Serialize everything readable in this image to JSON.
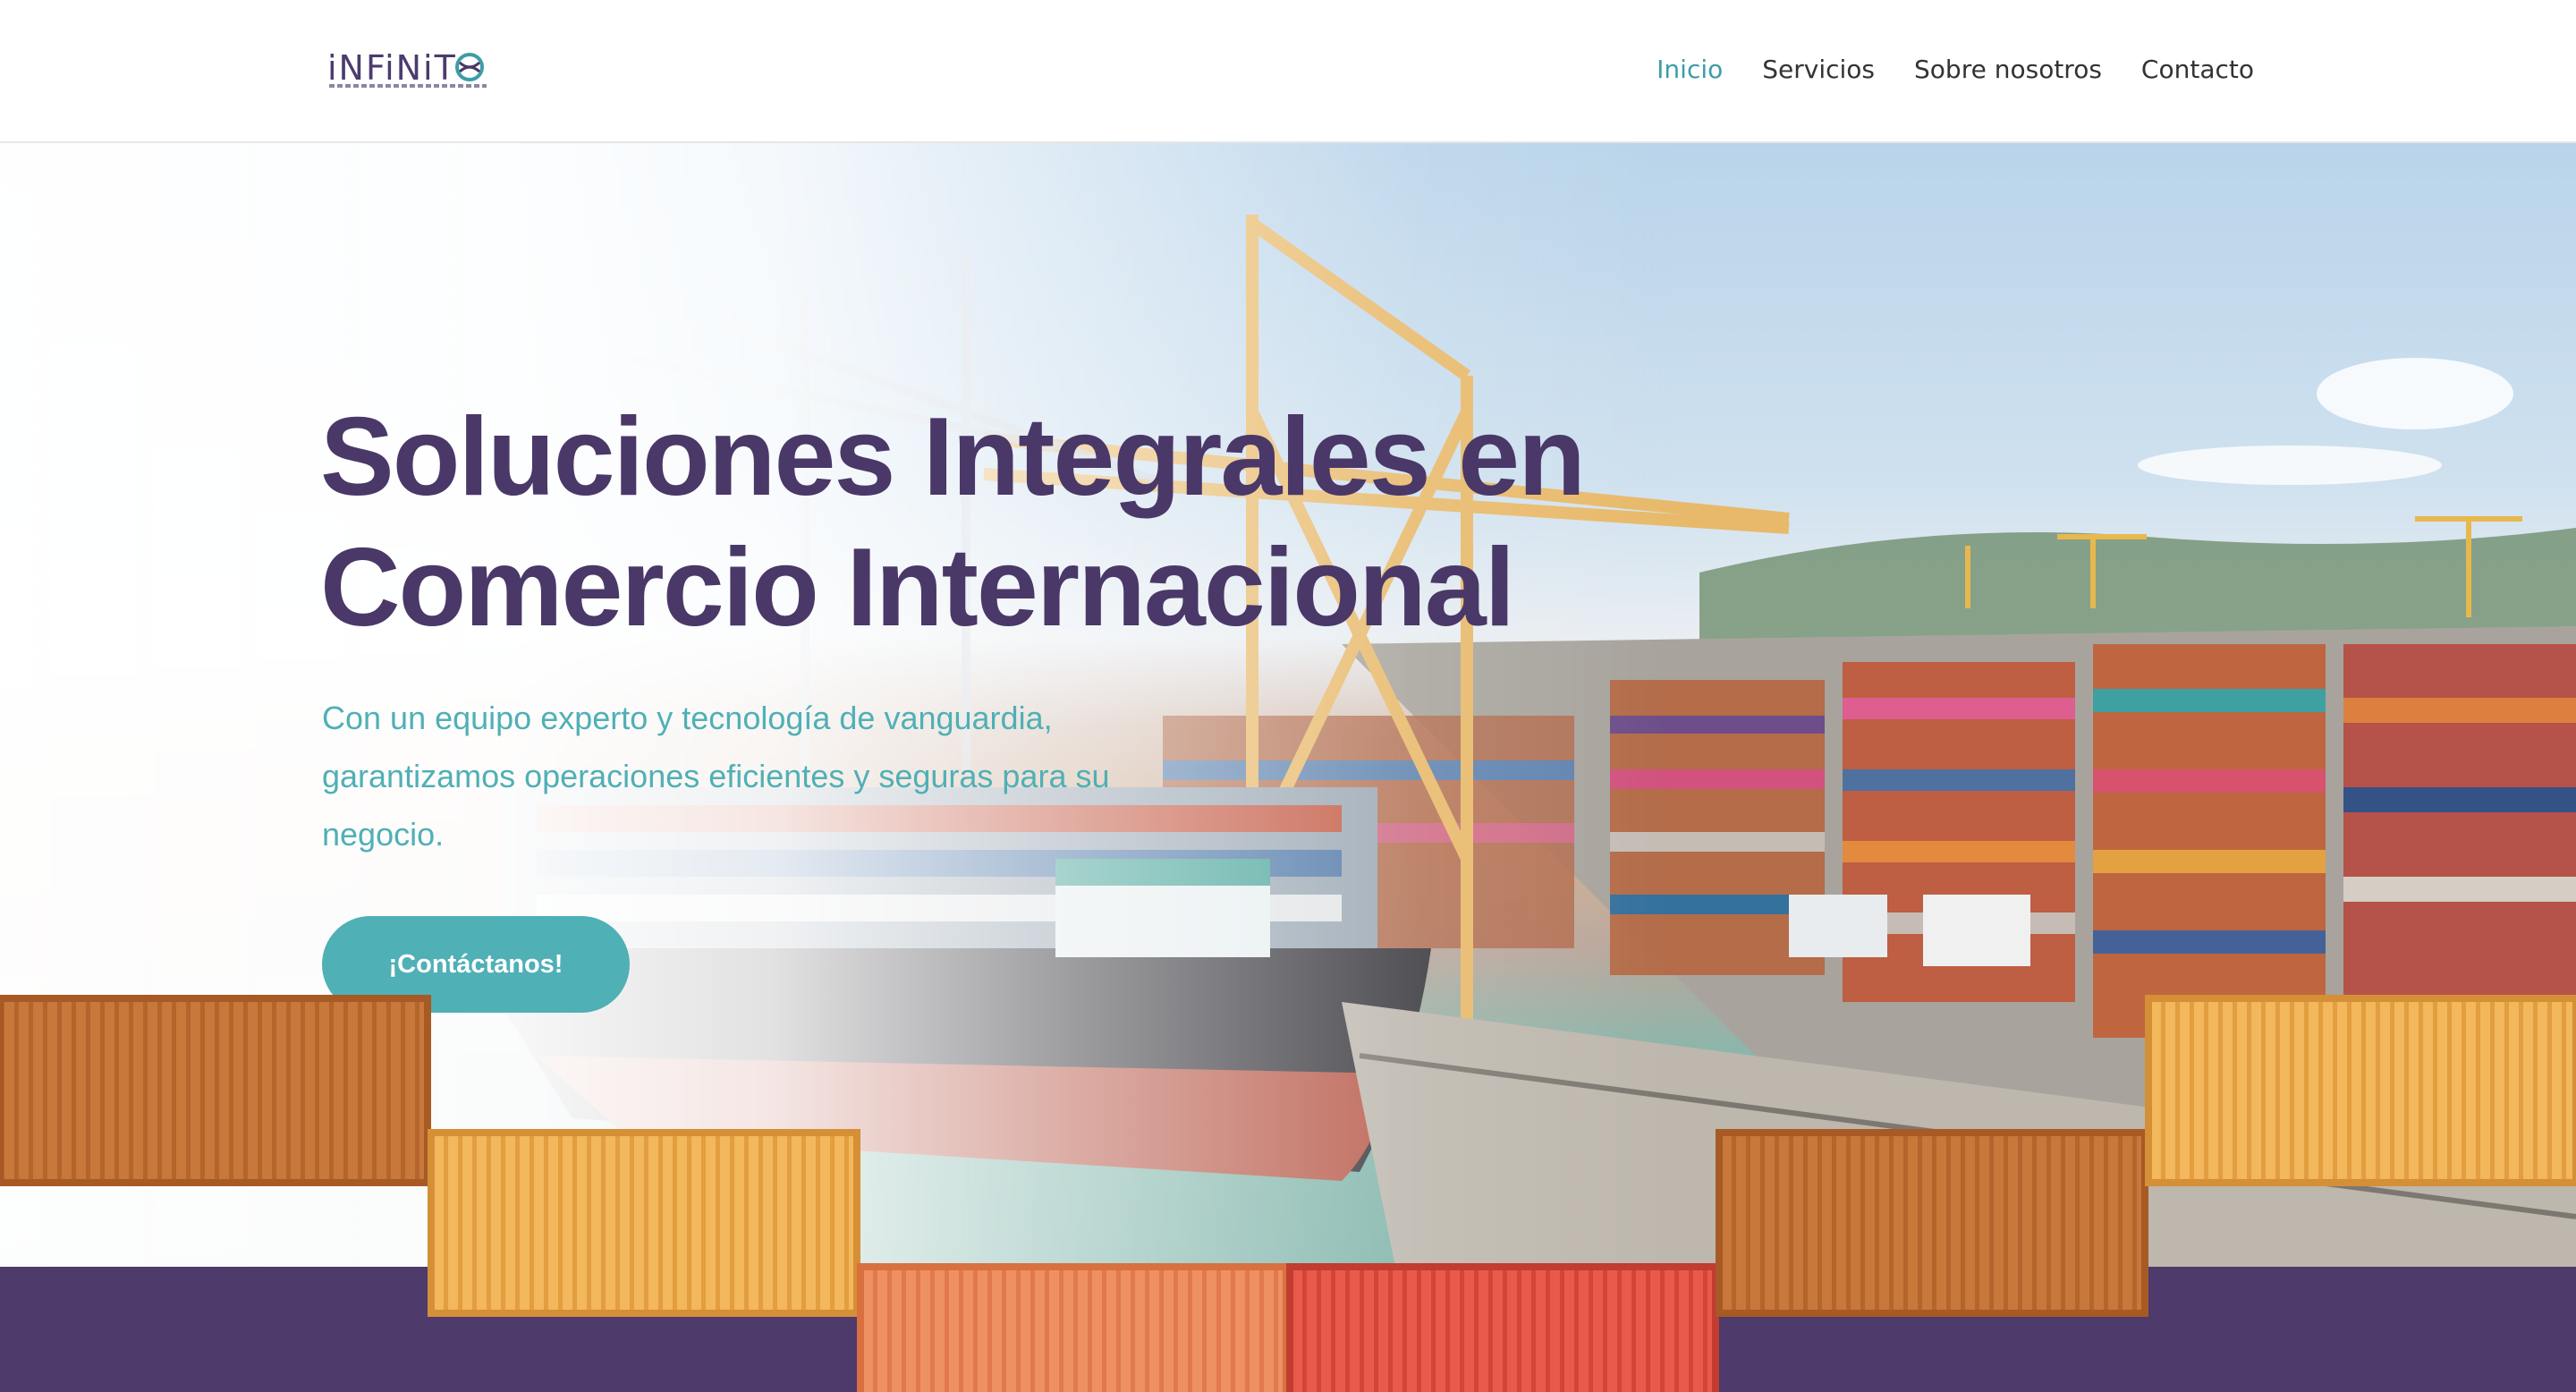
{
  "header": {
    "logo_text": "iNFiNiT",
    "logo_tagline": "EMPRESARIAL Y ADUANERO S.A. DE C.V.",
    "nav": [
      {
        "label": "Inicio",
        "active": true
      },
      {
        "label": "Servicios",
        "active": false
      },
      {
        "label": "Sobre nosotros",
        "active": false
      },
      {
        "label": "Contacto",
        "active": false
      }
    ]
  },
  "hero": {
    "title_line1": "Soluciones Integrales en",
    "title_line2": "Comercio Internacional",
    "subtitle": "Con un equipo experto y tecnología de vanguardia, garantizamos operaciones eficientes y seguras para su negocio.",
    "cta_label": "¡Contáctanos!",
    "background_image": "port-with-cranes-and-container-ship"
  },
  "colors": {
    "primary_purple": "#4a3868",
    "accent_teal": "#4fb0b6",
    "nav_active": "#3d9da7",
    "band_purple": "#4e3a6b",
    "container_orange": "#c8783a",
    "container_yellow": "#f0b45a",
    "container_salmon": "#ec8c5a",
    "container_red": "#e6574a"
  },
  "decorations": {
    "containers": [
      "orange",
      "yellow",
      "salmon",
      "red",
      "orange",
      "yellow"
    ]
  }
}
